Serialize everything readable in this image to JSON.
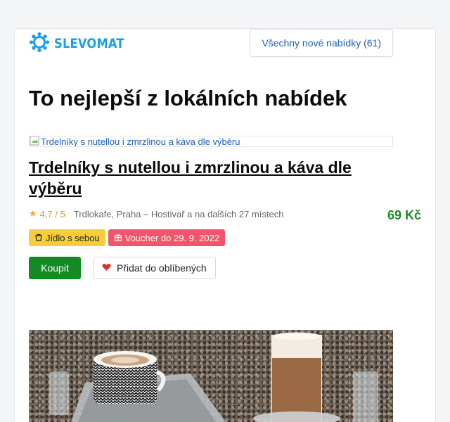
{
  "brand": {
    "name": "SLEVOMAT",
    "color": "#1aa0e6",
    "icon": "gear-icon"
  },
  "header": {
    "all_offers_label": "Všechny nové nabídky (61)"
  },
  "heading": "To nejlepší z lokálních nabídek",
  "deal": {
    "image_alt": "Trdelníky s nutellou i zmrzlinou a káva dle výběru",
    "title": "Trdelníky s nutellou i zmrzlinou a káva dle výběru",
    "rating": "4,7 / 5",
    "location": "Trdlokafe, Praha – Hostivař a na dalších 27 místech",
    "price": "69 Kč",
    "badges": [
      {
        "label": "Jídlo s sebou",
        "icon": "takeaway-icon",
        "color": "#f7ce3a"
      },
      {
        "label": "Voucher do 29. 9. 2022",
        "icon": "gift-icon",
        "color": "#f2556a"
      }
    ],
    "buy_label": "Koupit",
    "favorite_label": "Přidat do oblíbených"
  }
}
